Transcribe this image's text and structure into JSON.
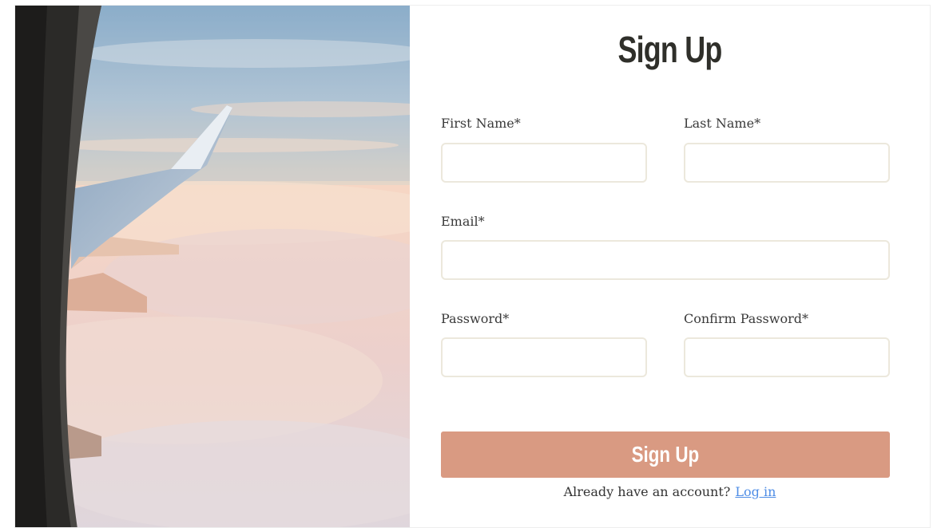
{
  "form": {
    "title": "Sign Up",
    "fields": {
      "first_name": {
        "label": "First Name*",
        "value": ""
      },
      "last_name": {
        "label": "Last Name*",
        "value": ""
      },
      "email": {
        "label": "Email*",
        "value": ""
      },
      "password": {
        "label": "Password*",
        "value": ""
      },
      "confirm_password": {
        "label": "Confirm Password*",
        "value": ""
      }
    },
    "submit_label": "Sign Up",
    "footer_text": "Already have an account?",
    "login_link": "Log in"
  },
  "colors": {
    "button": "#d99a82",
    "link": "#4f8de6",
    "field_border": "#ece8dc",
    "title": "#2f2f2a"
  }
}
